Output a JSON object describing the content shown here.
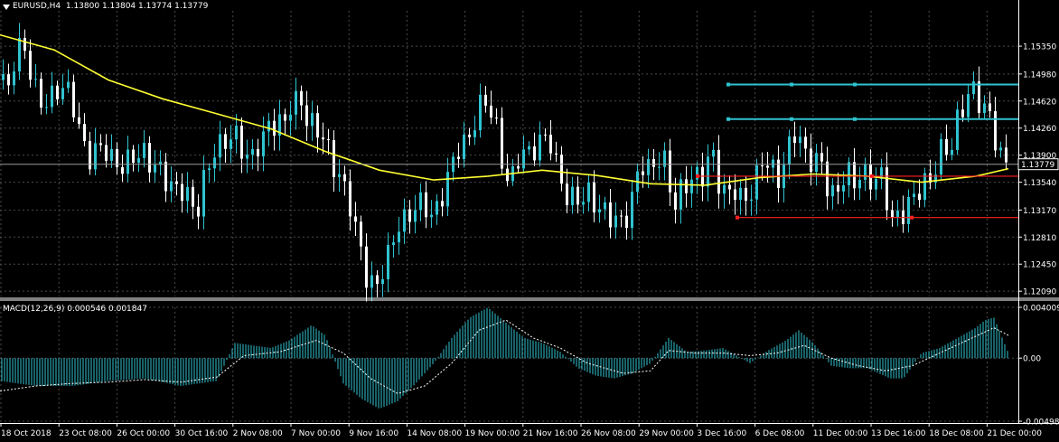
{
  "colors": {
    "background": "#000000",
    "grid": "#4a4a4a",
    "bull": "#2fc3d0",
    "bear": "#ffffff",
    "ma": "#ffff33",
    "macd": "#2fc3d0",
    "signal": "#ffffff",
    "hline_cyan": "#2fc3d0",
    "hline_red": "#ff2020",
    "bid_line": "#9a9a9a",
    "price_label_bg": "#000000"
  },
  "chart": {
    "symbol_timeframe": "EURUSD,H4",
    "ohlc_text": "1.13800 1.13804 1.13774 1.13779",
    "current_price_label": "1.13779",
    "current_price": 1.13779
  },
  "macd": {
    "label": "MACD(12,26,9) 0.000546 0.001847"
  },
  "chart_data": [
    {
      "type": "candlestick",
      "title": "EURUSD,H4",
      "ylim": [
        1.1202,
        1.1582
      ],
      "y_ticks": [
        "1.15350",
        "1.14980",
        "1.14620",
        "1.14260",
        "1.13900",
        "1.13540",
        "1.13170",
        "1.12810",
        "1.12450",
        "1.12090"
      ],
      "x_tick_labels": [
        "18 Oct 2018",
        "23 Oct 08:00",
        "26 Oct 00:00",
        "30 Oct 16:00",
        "2 Nov 08:00",
        "7 Nov 00:00",
        "9 Nov 16:00",
        "14 Nov 08:00",
        "19 Nov 00:00",
        "21 Nov 16:00",
        "26 Nov 08:00",
        "29 Nov 00:00",
        "3 Dec 16:00",
        "6 Dec 08:00",
        "11 Dec 00:00",
        "13 Dec 16:00",
        "18 Dec 08:00",
        "21 Dec 00:00"
      ],
      "close_path": [
        [
          0,
          1.149
        ],
        [
          6,
          1.146
        ],
        [
          12,
          1.151
        ],
        [
          18,
          1.153
        ],
        [
          24,
          1.155
        ],
        [
          30,
          1.152
        ],
        [
          36,
          1.149
        ],
        [
          42,
          1.147
        ],
        [
          48,
          1.146
        ],
        [
          54,
          1.146
        ],
        [
          60,
          1.147
        ],
        [
          66,
          1.147
        ],
        [
          72,
          1.147
        ],
        [
          78,
          1.146
        ],
        [
          84,
          1.143
        ],
        [
          90,
          1.141
        ],
        [
          96,
          1.139
        ],
        [
          102,
          1.14
        ],
        [
          108,
          1.141
        ],
        [
          114,
          1.141
        ],
        [
          120,
          1.139
        ],
        [
          126,
          1.138
        ],
        [
          132,
          1.137
        ],
        [
          138,
          1.137
        ],
        [
          144,
          1.138
        ],
        [
          150,
          1.138
        ],
        [
          156,
          1.139
        ],
        [
          162,
          1.138
        ],
        [
          168,
          1.138
        ],
        [
          174,
          1.138
        ],
        [
          180,
          1.137
        ],
        [
          186,
          1.136
        ],
        [
          192,
          1.135
        ],
        [
          198,
          1.135
        ],
        [
          204,
          1.134
        ],
        [
          210,
          1.132
        ],
        [
          216,
          1.13
        ],
        [
          222,
          1.134
        ],
        [
          228,
          1.136
        ],
        [
          234,
          1.139
        ],
        [
          240,
          1.14
        ],
        [
          246,
          1.141
        ],
        [
          252,
          1.142
        ],
        [
          258,
          1.143
        ],
        [
          264,
          1.141
        ],
        [
          270,
          1.14
        ],
        [
          276,
          1.138
        ],
        [
          282,
          1.14
        ],
        [
          288,
          1.14
        ],
        [
          294,
          1.142
        ],
        [
          300,
          1.142
        ],
        [
          306,
          1.143
        ],
        [
          312,
          1.142
        ],
        [
          318,
          1.146
        ],
        [
          324,
          1.146
        ],
        [
          330,
          1.148
        ],
        [
          336,
          1.145
        ],
        [
          342,
          1.144
        ],
        [
          348,
          1.143
        ],
        [
          354,
          1.142
        ],
        [
          360,
          1.14
        ],
        [
          366,
          1.137
        ],
        [
          372,
          1.136
        ],
        [
          378,
          1.134
        ],
        [
          384,
          1.133
        ],
        [
          390,
          1.13
        ],
        [
          396,
          1.128
        ],
        [
          402,
          1.124
        ],
        [
          408,
          1.123
        ],
        [
          414,
          1.122
        ],
        [
          420,
          1.124
        ],
        [
          426,
          1.125
        ],
        [
          432,
          1.127
        ],
        [
          438,
          1.129
        ],
        [
          444,
          1.129
        ],
        [
          450,
          1.13
        ],
        [
          456,
          1.131
        ],
        [
          462,
          1.132
        ],
        [
          468,
          1.133
        ],
        [
          474,
          1.131
        ],
        [
          480,
          1.132
        ],
        [
          486,
          1.134
        ],
        [
          492,
          1.136
        ],
        [
          498,
          1.138
        ],
        [
          504,
          1.14
        ],
        [
          510,
          1.14
        ],
        [
          516,
          1.14
        ],
        [
          522,
          1.142
        ],
        [
          528,
          1.144
        ],
        [
          534,
          1.146
        ],
        [
          540,
          1.145
        ],
        [
          546,
          1.144
        ],
        [
          552,
          1.14
        ],
        [
          558,
          1.137
        ],
        [
          564,
          1.136
        ],
        [
          570,
          1.139
        ],
        [
          576,
          1.14
        ],
        [
          582,
          1.139
        ],
        [
          588,
          1.139
        ],
        [
          594,
          1.14
        ],
        [
          600,
          1.14
        ],
        [
          606,
          1.141
        ],
        [
          612,
          1.138
        ],
        [
          618,
          1.136
        ],
        [
          624,
          1.134
        ],
        [
          630,
          1.134
        ],
        [
          636,
          1.134
        ],
        [
          642,
          1.134
        ],
        [
          648,
          1.135
        ],
        [
          654,
          1.133
        ],
        [
          660,
          1.132
        ],
        [
          666,
          1.131
        ],
        [
          672,
          1.13
        ],
        [
          678,
          1.13
        ],
        [
          684,
          1.129
        ],
        [
          690,
          1.13
        ],
        [
          696,
          1.132
        ],
        [
          702,
          1.136
        ],
        [
          708,
          1.139
        ],
        [
          714,
          1.138
        ],
        [
          720,
          1.138
        ],
        [
          726,
          1.139
        ],
        [
          732,
          1.139
        ],
        [
          738,
          1.136
        ],
        [
          744,
          1.131
        ],
        [
          750,
          1.133
        ],
        [
          756,
          1.134
        ],
        [
          762,
          1.135
        ],
        [
          768,
          1.136
        ],
        [
          774,
          1.136
        ],
        [
          780,
          1.138
        ],
        [
          786,
          1.141
        ],
        [
          792,
          1.137
        ],
        [
          798,
          1.135
        ],
        [
          804,
          1.134
        ],
        [
          810,
          1.135
        ],
        [
          816,
          1.133
        ],
        [
          822,
          1.132
        ],
        [
          828,
          1.133
        ],
        [
          834,
          1.134
        ],
        [
          840,
          1.138
        ],
        [
          846,
          1.138
        ],
        [
          852,
          1.138
        ],
        [
          858,
          1.136
        ],
        [
          864,
          1.138
        ],
        [
          870,
          1.14
        ],
        [
          876,
          1.143
        ],
        [
          882,
          1.142
        ],
        [
          888,
          1.139
        ],
        [
          894,
          1.138
        ],
        [
          900,
          1.137
        ],
        [
          906,
          1.138
        ],
        [
          912,
          1.135
        ],
        [
          918,
          1.133
        ],
        [
          924,
          1.134
        ],
        [
          930,
          1.136
        ],
        [
          936,
          1.138
        ],
        [
          942,
          1.136
        ],
        [
          948,
          1.137
        ],
        [
          954,
          1.137
        ],
        [
          960,
          1.136
        ],
        [
          966,
          1.135
        ],
        [
          972,
          1.136
        ],
        [
          978,
          1.134
        ],
        [
          984,
          1.129
        ],
        [
          990,
          1.13
        ],
        [
          996,
          1.131
        ],
        [
          1002,
          1.132
        ],
        [
          1008,
          1.134
        ],
        [
          1014,
          1.135
        ],
        [
          1020,
          1.136
        ],
        [
          1026,
          1.136
        ],
        [
          1032,
          1.137
        ],
        [
          1038,
          1.139
        ],
        [
          1044,
          1.14
        ],
        [
          1050,
          1.138
        ],
        [
          1056,
          1.142
        ],
        [
          1062,
          1.144
        ],
        [
          1068,
          1.146
        ],
        [
          1074,
          1.148
        ],
        [
          1080,
          1.147
        ],
        [
          1086,
          1.146
        ],
        [
          1092,
          1.146
        ],
        [
          1098,
          1.143
        ],
        [
          1104,
          1.14
        ],
        [
          1110,
          1.138
        ],
        [
          1116,
          1.1378
        ]
      ],
      "moving_average": [
        [
          0,
          1.155
        ],
        [
          60,
          1.153
        ],
        [
          120,
          1.149
        ],
        [
          180,
          1.1465
        ],
        [
          240,
          1.1445
        ],
        [
          300,
          1.1425
        ],
        [
          360,
          1.1395
        ],
        [
          420,
          1.137
        ],
        [
          480,
          1.1357
        ],
        [
          540,
          1.1362
        ],
        [
          600,
          1.137
        ],
        [
          660,
          1.1363
        ],
        [
          720,
          1.1352
        ],
        [
          780,
          1.135
        ],
        [
          840,
          1.136
        ],
        [
          900,
          1.1365
        ],
        [
          960,
          1.1362
        ],
        [
          1020,
          1.1354
        ],
        [
          1080,
          1.1362
        ],
        [
          1116,
          1.1372
        ]
      ],
      "horizontal_lines": [
        {
          "color": "cyan",
          "price": 1.1484,
          "x_start": 806
        },
        {
          "color": "cyan",
          "price": 1.1438,
          "x_start": 806
        },
        {
          "color": "red",
          "price": 1.1362,
          "x_start": 772
        },
        {
          "color": "red",
          "price": 1.1307,
          "x_start": 816
        }
      ]
    },
    {
      "type": "bar",
      "title": "MACD(12,26,9)",
      "ylim": [
        -0.00498,
        0.004009
      ],
      "y_ticks": [
        "0.004009",
        "0.00",
        "-0.00498"
      ],
      "histogram": [
        [
          0,
          -0.0018
        ],
        [
          40,
          -0.0022
        ],
        [
          80,
          -0.0022
        ],
        [
          120,
          -0.0018
        ],
        [
          160,
          -0.0016
        ],
        [
          200,
          -0.0022
        ],
        [
          240,
          -0.0018
        ],
        [
          260,
          0.0012
        ],
        [
          300,
          0.0008
        ],
        [
          320,
          0.0014
        ],
        [
          345,
          0.0026
        ],
        [
          360,
          0.0018
        ],
        [
          380,
          -0.002
        ],
        [
          400,
          -0.0032
        ],
        [
          420,
          -0.004
        ],
        [
          440,
          -0.0034
        ],
        [
          460,
          -0.002
        ],
        [
          480,
          -0.0004
        ],
        [
          500,
          0.0016
        ],
        [
          520,
          0.0032
        ],
        [
          540,
          0.004
        ],
        [
          560,
          0.0028
        ],
        [
          580,
          0.0016
        ],
        [
          600,
          0.0012
        ],
        [
          620,
          0.0005
        ],
        [
          640,
          -0.0008
        ],
        [
          660,
          -0.0014
        ],
        [
          680,
          -0.0016
        ],
        [
          700,
          -0.0012
        ],
        [
          720,
          -0.0004
        ],
        [
          740,
          0.0016
        ],
        [
          760,
          0.0005
        ],
        [
          780,
          0.0006
        ],
        [
          800,
          0.0008
        ],
        [
          830,
          -0.0004
        ],
        [
          850,
          0.0006
        ],
        [
          870,
          0.0014
        ],
        [
          884,
          0.0022
        ],
        [
          900,
          0.0012
        ],
        [
          920,
          -0.0006
        ],
        [
          940,
          -0.0008
        ],
        [
          960,
          -0.0008
        ],
        [
          985,
          -0.0016
        ],
        [
          1000,
          -0.0016
        ],
        [
          1020,
          0.0004
        ],
        [
          1040,
          0.0008
        ],
        [
          1060,
          0.0016
        ],
        [
          1080,
          0.0024
        ],
        [
          1090,
          0.003
        ],
        [
          1100,
          0.0032
        ],
        [
          1116,
          0.0004
        ]
      ],
      "signal": [
        [
          0,
          -0.0026
        ],
        [
          40,
          -0.0022
        ],
        [
          80,
          -0.002
        ],
        [
          120,
          -0.0019
        ],
        [
          160,
          -0.0017
        ],
        [
          200,
          -0.0019
        ],
        [
          240,
          -0.0015
        ],
        [
          270,
          0.0002
        ],
        [
          310,
          0.0005
        ],
        [
          350,
          0.0014
        ],
        [
          380,
          0.0004
        ],
        [
          410,
          -0.0016
        ],
        [
          440,
          -0.0028
        ],
        [
          470,
          -0.0022
        ],
        [
          500,
          -0.0004
        ],
        [
          530,
          0.0022
        ],
        [
          560,
          0.003
        ],
        [
          590,
          0.0016
        ],
        [
          620,
          0.0008
        ],
        [
          650,
          -0.0004
        ],
        [
          690,
          -0.0012
        ],
        [
          720,
          -0.001
        ],
        [
          740,
          0.0006
        ],
        [
          770,
          0.0004
        ],
        [
          800,
          0.0004
        ],
        [
          830,
          0.0002
        ],
        [
          860,
          0.0004
        ],
        [
          890,
          0.001
        ],
        [
          920,
          0
        ],
        [
          950,
          -0.0006
        ],
        [
          980,
          -0.001
        ],
        [
          1010,
          -0.0006
        ],
        [
          1040,
          0.0004
        ],
        [
          1070,
          0.0014
        ],
        [
          1100,
          0.0024
        ],
        [
          1116,
          0.0018
        ]
      ]
    }
  ]
}
